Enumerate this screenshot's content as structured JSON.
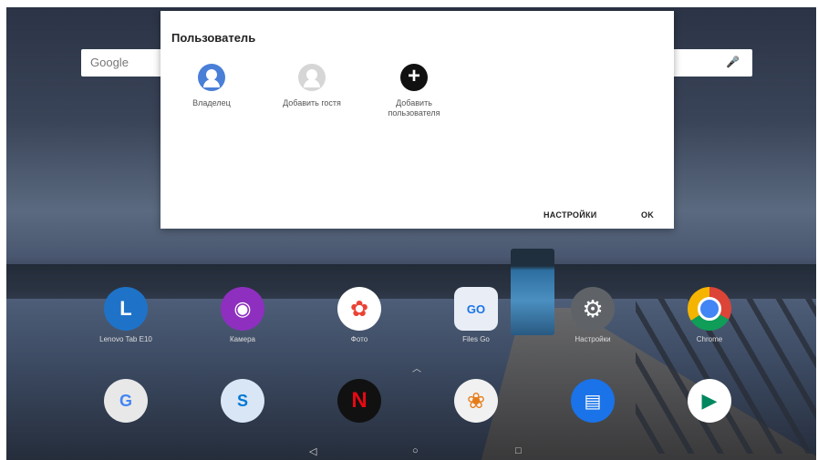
{
  "google": {
    "logo": "Google",
    "mic_icon": "mic-icon"
  },
  "dialog": {
    "title": "Пользователь",
    "users": [
      {
        "label": "Владелец",
        "icon": "owner-avatar-icon",
        "color": "#4a7fd8"
      },
      {
        "label": "Добавить гостя",
        "icon": "guest-avatar-icon",
        "color": "#bdbdbd"
      },
      {
        "label": "Добавить пользователя",
        "icon": "add-user-icon",
        "color": "#111111"
      }
    ],
    "settings_label": "НАСТРОЙКИ",
    "ok_label": "OK"
  },
  "apps_row1": [
    {
      "label": "Lenovo Tab E10",
      "icon": "lenovo-icon",
      "color": "#1e73c8",
      "glyph": "L"
    },
    {
      "label": "Камера",
      "icon": "camera-icon",
      "color": "#8e2fc0",
      "glyph": "◉"
    },
    {
      "label": "Фото",
      "icon": "photos-icon",
      "color": "#ffffff",
      "glyph": "✿"
    },
    {
      "label": "Files Go",
      "icon": "files-go-icon",
      "color": "#e9eef6",
      "glyph": "GO"
    },
    {
      "label": "Настройки",
      "icon": "settings-icon",
      "color": "#5f6368",
      "glyph": "⚙"
    },
    {
      "label": "Chrome",
      "icon": "chrome-icon",
      "color": "#db4437",
      "glyph": "◎"
    }
  ],
  "apps_row2": [
    {
      "icon": "google-folder-icon",
      "color": "#e8e8e8",
      "glyph": "G"
    },
    {
      "icon": "skype-outlook-folder-icon",
      "color": "#d9e6f5",
      "glyph": "S"
    },
    {
      "icon": "netflix-icon",
      "color": "#111111",
      "glyph": "N"
    },
    {
      "icon": "gallery-icon",
      "color": "#f1f1f1",
      "glyph": "❀"
    },
    {
      "icon": "messages-icon",
      "color": "#1a73e8",
      "glyph": "▤"
    },
    {
      "icon": "play-store-icon",
      "color": "#ffffff",
      "glyph": "▶"
    }
  ],
  "nav": {
    "back": "◁",
    "home": "○",
    "recents": "□"
  }
}
